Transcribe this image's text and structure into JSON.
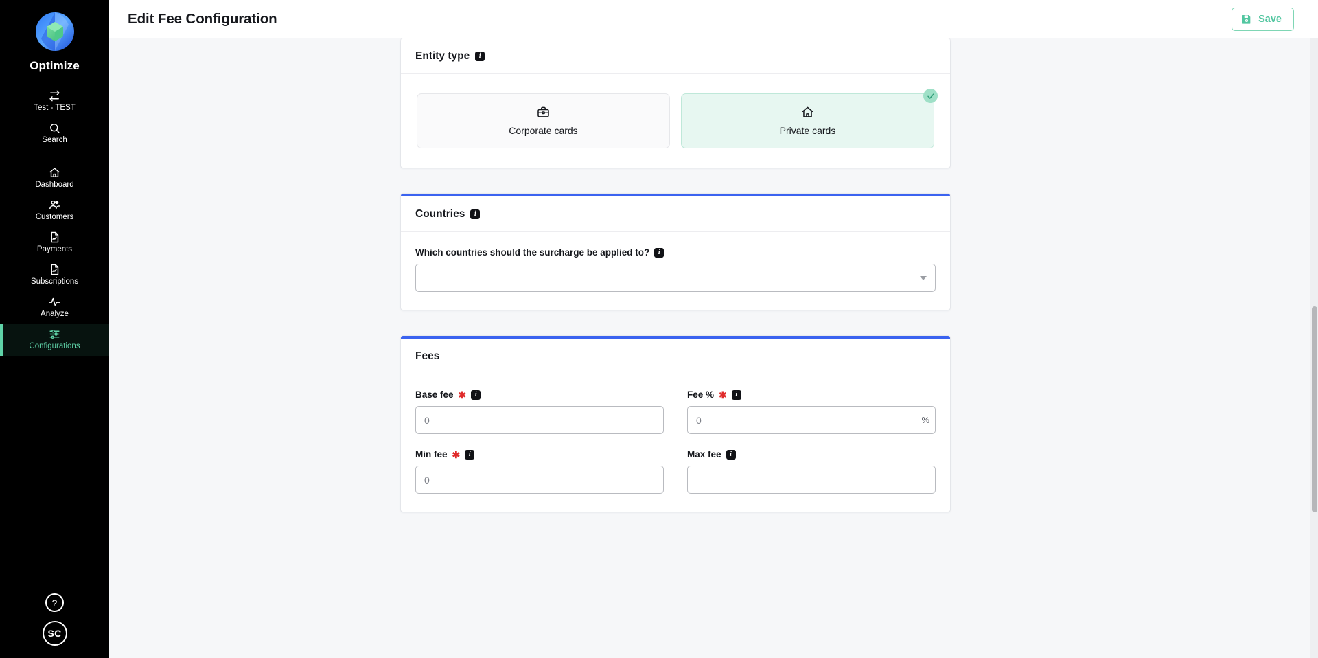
{
  "sidebar": {
    "brand_name": "Optimize",
    "logo_icon": "optimize-logo",
    "nav_top": [
      {
        "label": "Test - TEST",
        "icon": "swap-arrows-icon",
        "active": false
      },
      {
        "label": "Search",
        "icon": "search-icon",
        "active": false
      }
    ],
    "nav_main": [
      {
        "label": "Dashboard",
        "icon": "home-icon",
        "active": false
      },
      {
        "label": "Customers",
        "icon": "users-icon",
        "active": false
      },
      {
        "label": "Payments",
        "icon": "document-chart-icon",
        "active": false
      },
      {
        "label": "Subscriptions",
        "icon": "document-chart-icon",
        "active": false
      },
      {
        "label": "Analyze",
        "icon": "pulse-icon",
        "active": false
      },
      {
        "label": "Configurations",
        "icon": "sliders-icon",
        "active": true
      }
    ],
    "help_label": "?",
    "help_icon": "help-circle-icon",
    "avatar_initials": "SC",
    "active_color": "#5fd3a8"
  },
  "header": {
    "title": "Edit Fee Configuration",
    "save_label": "Save",
    "save_icon": "save-disk-icon",
    "save_color": "#52c6a0"
  },
  "entity_type": {
    "title": "Entity type",
    "info_icon": "info-icon",
    "options": [
      {
        "label": "Corporate cards",
        "icon": "briefcase-icon",
        "selected": false
      },
      {
        "label": "Private cards",
        "icon": "home-icon",
        "selected": true
      }
    ],
    "check_icon": "check-icon"
  },
  "countries": {
    "title": "Countries",
    "info_icon": "info-icon",
    "question_label": "Which countries should the surcharge be applied to?",
    "question_info_icon": "info-icon",
    "select_value": "",
    "select_placeholder": "",
    "caret_icon": "chevron-down-icon",
    "accent_color": "#3b63f0"
  },
  "fees": {
    "title": "Fees",
    "accent_color": "#3b63f0",
    "fields": [
      {
        "label": "Base fee",
        "required": true,
        "info_icon": "info-icon",
        "value": "",
        "placeholder": "0",
        "suffix": ""
      },
      {
        "label": "Fee %",
        "required": true,
        "info_icon": "info-icon",
        "value": "",
        "placeholder": "0",
        "suffix": "%"
      },
      {
        "label": "Min fee",
        "required": true,
        "info_icon": "info-icon",
        "value": "",
        "placeholder": "0",
        "suffix": ""
      },
      {
        "label": "Max fee",
        "required": false,
        "info_icon": "info-icon",
        "value": "",
        "placeholder": "",
        "suffix": ""
      }
    ],
    "required_marker": "✱"
  }
}
